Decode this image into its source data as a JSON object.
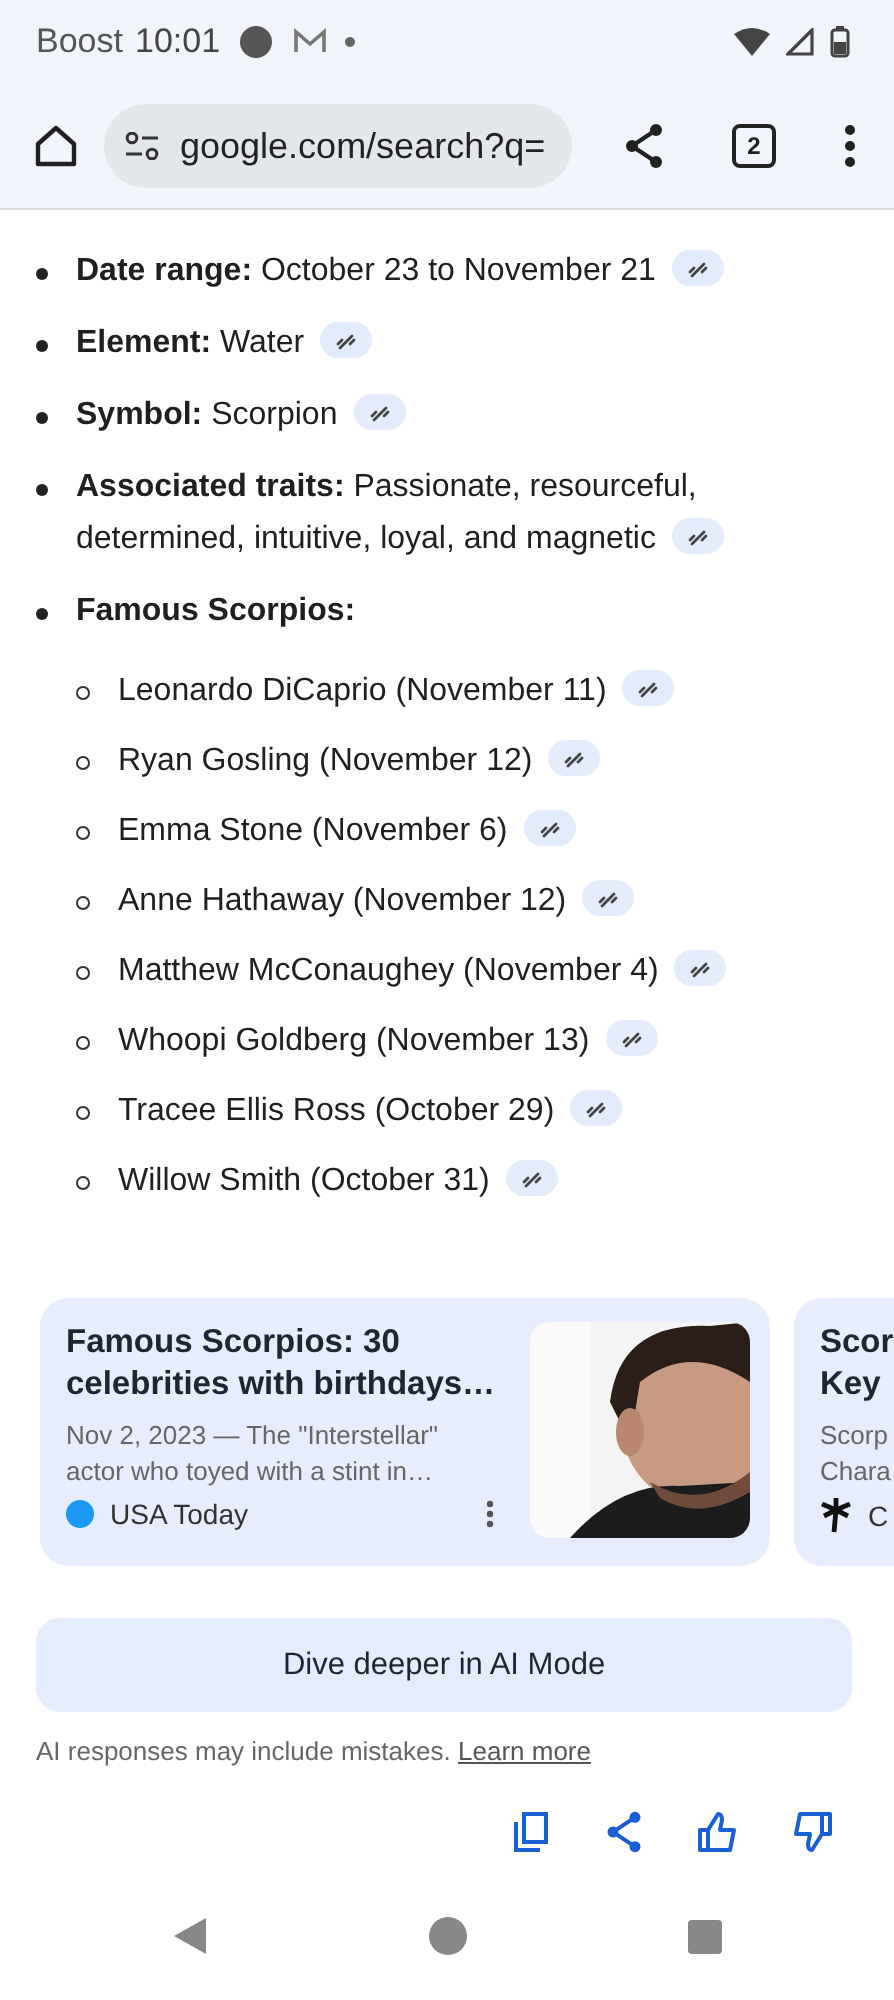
{
  "status_bar": {
    "carrier": "Boost",
    "time": "10:01"
  },
  "toolbar": {
    "url": "google.com/search?q=",
    "tab_count": "2"
  },
  "facts": [
    {
      "label": "Date range:",
      "text": "October 23 to November 21"
    },
    {
      "label": "Element:",
      "text": "Water"
    },
    {
      "label": "Symbol:",
      "text": "Scorpion"
    },
    {
      "label": "Associated traits:",
      "text": "Passionate, resourceful, determined, intuitive, loyal, and magnetic"
    },
    {
      "label": "Famous Scorpios:",
      "children": [
        {
          "text": "Leonardo DiCaprio (November 11)"
        },
        {
          "text": "Ryan Gosling (November 12)"
        },
        {
          "text": "Emma Stone (November 6)"
        },
        {
          "text": "Anne Hathaway (November 12)"
        },
        {
          "text": "Matthew McConaughey (November 4)"
        },
        {
          "text": "Whoopi Goldberg (November 13)"
        },
        {
          "text": "Tracee Ellis Ross (October 29)"
        },
        {
          "text": "Willow Smith (October 31)"
        }
      ]
    }
  ],
  "cards": [
    {
      "title_lines": [
        "Famous Scorpios: 30",
        "celebrities with birthdays…"
      ],
      "snippet_lines": [
        "Nov 2, 2023 — The \"Interstellar\"",
        "actor who toyed with a stint in…"
      ],
      "source": "USA Today",
      "logo": {
        "kind": "dot",
        "color": "#1a9af5"
      },
      "menu": true,
      "kind": "picture"
    },
    {
      "title_lines": [
        "Scor",
        "Key"
      ],
      "snippet_lines": [
        "Scorp",
        "Chara"
      ],
      "source": "C",
      "logo": {
        "kind": "palm"
      },
      "menu": false
    }
  ],
  "ai_mode_button": "Dive deeper in AI Mode",
  "disclaimer": {
    "text": "AI responses may include mistakes.",
    "link": "Learn more"
  }
}
